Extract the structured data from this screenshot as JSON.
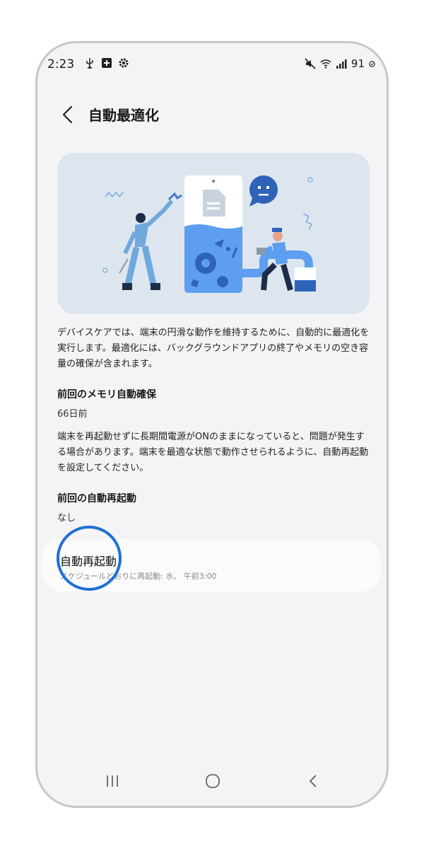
{
  "status_bar": {
    "time": "2:23",
    "battery": "91"
  },
  "header": {
    "title": "自動最適化"
  },
  "content": {
    "description": "デバイスケアでは、端末の円滑な動作を維持するために、自動的に最適化を実行します。最適化には、バックグラウンドアプリの終了やメモリの空き容量の確保が含まれます。",
    "memory_section": {
      "title": "前回のメモリ自動確保",
      "value": "66日前"
    },
    "restart_description": "端末を再起動せずに長期間電源がONのままになっていると、問題が発生する場合があります。端末を最適な状態で動作させられるように、自動再起動を設定してください。",
    "restart_section": {
      "title": "前回の自動再起動",
      "value": "なし"
    },
    "auto_restart_card": {
      "title": "自動再起動",
      "subtitle": "スケジュールどおりに再起動: 水、 午前3:00"
    }
  },
  "icons": {
    "back": "chevron-left-icon",
    "nav_recents": "recents-icon",
    "nav_home": "home-icon",
    "nav_back": "back-icon"
  },
  "colors": {
    "accent": "#1f6fd6",
    "background": "#f4f4f6",
    "hero_bg": "#dde6ef"
  }
}
